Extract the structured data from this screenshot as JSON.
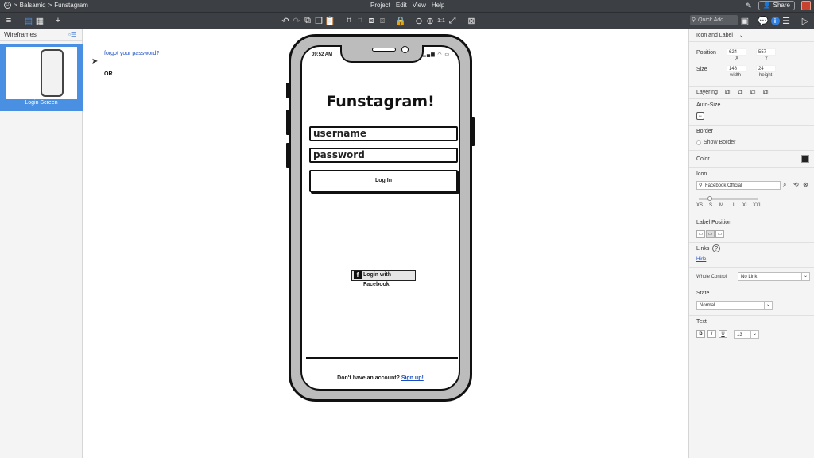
{
  "titlebar": {
    "breadcrumb_root": "Balsamiq",
    "breadcrumb_sep": ">",
    "breadcrumb_project": "Funstagram",
    "menu": [
      "Project",
      "Edit",
      "View",
      "Help"
    ],
    "share_label": "Share"
  },
  "toolbar": {
    "quick_add_placeholder": "Quick Add"
  },
  "left_panel": {
    "header": "Wireframes",
    "thumbnail_label": "Login Screen"
  },
  "canvas": {
    "forgot_link": "forgot your password?",
    "or_label": "OR"
  },
  "phone": {
    "status_time": "09:52 AM",
    "status_icons": "▂▄▆ ◠ ▭",
    "app_title": "Funstagram!",
    "username_placeholder": "username",
    "password_placeholder": "password",
    "login_label": "Log In",
    "facebook_label": "Login with Facebook",
    "signup_text": "Don't have an account?",
    "signup_link": "Sign up!"
  },
  "inspector": {
    "header": "Icon and Label",
    "position_label": "Position",
    "position_x": "624",
    "position_y": "557",
    "x_caption": "X",
    "y_caption": "Y",
    "size_label": "Size",
    "size_w": "148",
    "size_h": "24",
    "width_caption": "width",
    "height_caption": "height",
    "layering_label": "Layering",
    "autosize_label": "Auto-Size",
    "border_label": "Border",
    "show_border_label": "Show Border",
    "color_label": "Color",
    "color_value": "#222222",
    "icon_label": "Icon",
    "icon_value": "Facebook Official",
    "icon_sizes": [
      "XS",
      "S",
      "M",
      "L",
      "XL",
      "XXL"
    ],
    "label_position_label": "Label Position",
    "links_label": "Links",
    "links_hide": "Hide",
    "whole_control_label": "Whole Control",
    "whole_control_value": "No Link",
    "state_label": "State",
    "state_value": "Normal",
    "text_label": "Text",
    "bold": "B",
    "italic": "I",
    "underline": "U",
    "font_size": "13"
  },
  "colors": {
    "chrome": "#3c3f44",
    "accent": "#4a90e2",
    "link": "#1a4fc4"
  }
}
